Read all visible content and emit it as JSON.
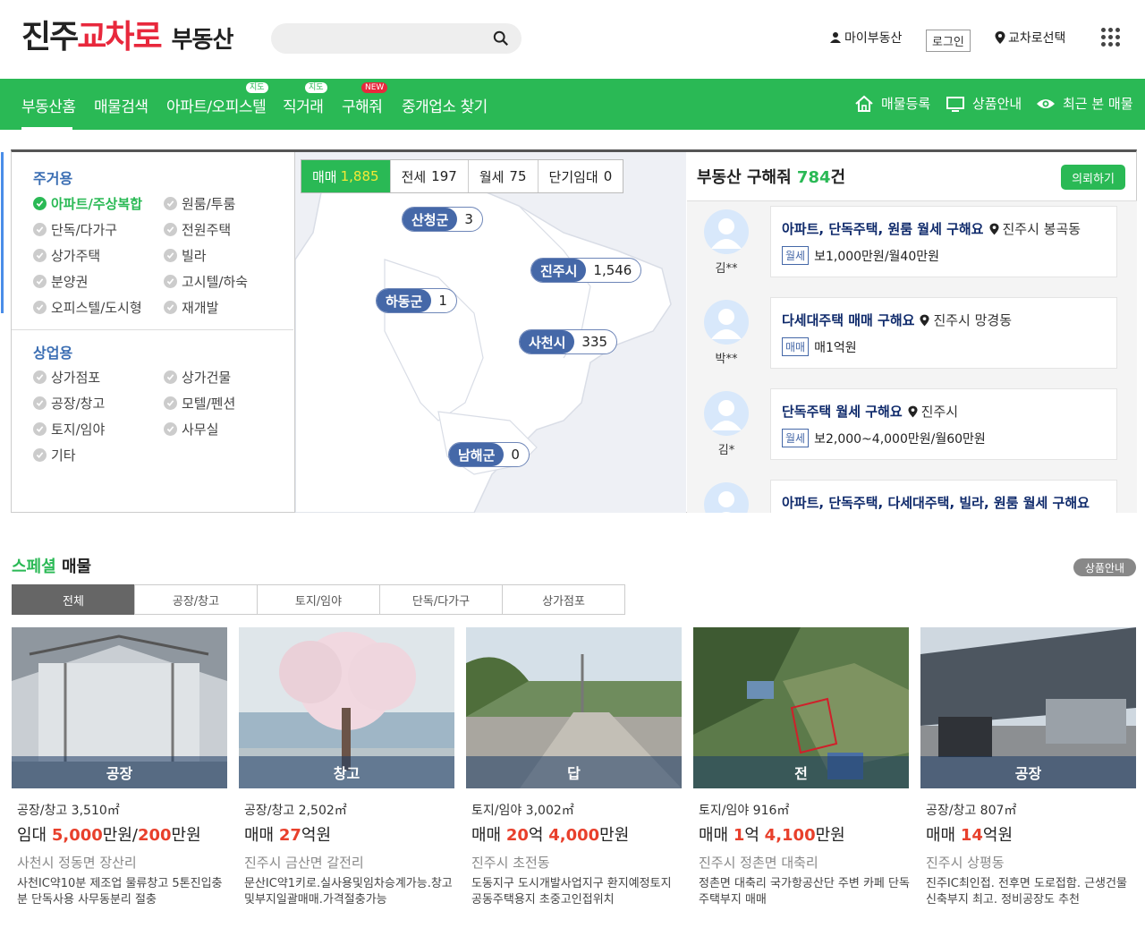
{
  "header": {
    "logo": {
      "part1": "진주",
      "part2": "교차로",
      "part3": "부동산"
    },
    "search": {
      "placeholder": ""
    },
    "my_realty": "마이부동산",
    "login": "로그인",
    "select_crossroad": "교차로선택"
  },
  "nav": {
    "items": [
      {
        "label": "부동산홈"
      },
      {
        "label": "매물검색"
      },
      {
        "label": "아파트/오피스텔",
        "badge": "지도"
      },
      {
        "label": "직거래",
        "badge": "지도"
      },
      {
        "label": "구해줘",
        "badge": "NEW"
      },
      {
        "label": "중개업소 찾기"
      }
    ],
    "right": {
      "register": "매물등록",
      "products": "상품안내",
      "recent": "최근 본 매물"
    }
  },
  "categories": {
    "residential_title": "주거용",
    "residential": [
      "아파트/주상복합",
      "원룸/투룸",
      "단독/다가구",
      "전원주택",
      "상가주택",
      "빌라",
      "분양권",
      "고시텔/하숙",
      "오피스텔/도시형",
      "재개발"
    ],
    "commercial_title": "상업용",
    "commercial": [
      "상가점포",
      "상가건물",
      "공장/창고",
      "모텔/펜션",
      "토지/임야",
      "사무실",
      "기타"
    ]
  },
  "map": {
    "tabs": [
      {
        "label": "매매",
        "count": "1,885"
      },
      {
        "label": "전세",
        "count": "197"
      },
      {
        "label": "월세",
        "count": "75"
      },
      {
        "label": "단기임대",
        "count": "0"
      }
    ],
    "regions": [
      {
        "name": "산청군",
        "count": "3"
      },
      {
        "name": "진주시",
        "count": "1,546"
      },
      {
        "name": "하동군",
        "count": "1"
      },
      {
        "name": "사천시",
        "count": "335"
      },
      {
        "name": "남해군",
        "count": "0"
      }
    ]
  },
  "requests": {
    "title": "부동산 구해줘",
    "count": "784",
    "unit": "건",
    "button": "의뢰하기",
    "items": [
      {
        "user": "김**",
        "title": "아파트, 단독주택, 원룸 월세 구해요",
        "location": "진주시 봉곡동",
        "kind": "월세",
        "price": "보1,000만원/월40만원"
      },
      {
        "user": "박**",
        "title": "다세대주택 매매 구해요",
        "location": "진주시 망경동",
        "kind": "매매",
        "price": "매1억원"
      },
      {
        "user": "김*",
        "title": "단독주택 월세 구해요",
        "location": "진주시",
        "kind": "월세",
        "price": "보2,000~4,000만원/월60만원"
      },
      {
        "user": "",
        "title": "아파트, 단독주택, 다세대주택, 빌라, 원룸 월세 구해요",
        "location": "",
        "kind": "",
        "price": ""
      }
    ]
  },
  "special": {
    "title_green": "스페셜",
    "title_rest": " 매물",
    "info_button": "상품안내",
    "tabs": [
      "전체",
      "공장/창고",
      "토지/임야",
      "단독/다가구",
      "상가점포"
    ],
    "products": [
      {
        "caption": "공장",
        "type": "공장/창고 3,510㎡",
        "price_pre": "임대 ",
        "price_parts": [
          [
            "5,000",
            "만원/"
          ],
          [
            "200",
            "만원"
          ]
        ],
        "loc": "사천시 정동면 장산리",
        "desc": "사천IC약10분 제조업 물류창고 5톤진입충분 단독사용 사무동분리 절충"
      },
      {
        "caption": "창고",
        "type": "공장/창고 2,502㎡",
        "price_pre": "매매 ",
        "price_parts": [
          [
            "27",
            "억원"
          ]
        ],
        "loc": "진주시 금산면 갈전리",
        "desc": "문산IC약1키로.실사용및임차승계가능.창고및부지일괄매매.가격절충가능"
      },
      {
        "caption": "답",
        "type": "토지/임야 3,002㎡",
        "price_pre": "매매 ",
        "price_parts": [
          [
            "20",
            "억 "
          ],
          [
            "4,000",
            "만원"
          ]
        ],
        "loc": "진주시 초전동",
        "desc": "도동지구 도시개발사업지구 환지예정토지 공동주택용지 초중고인접위치"
      },
      {
        "caption": "전",
        "type": "토지/임야 916㎡",
        "price_pre": "매매 ",
        "price_parts": [
          [
            "1",
            "억 "
          ],
          [
            "4,100",
            "만원"
          ]
        ],
        "loc": "진주시 정촌면 대축리",
        "desc": "정촌면 대축리 국가항공산단 주변 카페 단독주택부지 매매"
      },
      {
        "caption": "공장",
        "type": "공장/창고 807㎡",
        "price_pre": "매매 ",
        "price_parts": [
          [
            "14",
            "억원"
          ]
        ],
        "loc": "진주시 상평동",
        "desc": "진주IC최인접. 전후면 도로접함. 근생건물신축부지 최고. 정비공장도 추천"
      }
    ]
  },
  "colors": {
    "green": "#2ab955",
    "red": "#e8283c",
    "navy": "#4568a8"
  }
}
